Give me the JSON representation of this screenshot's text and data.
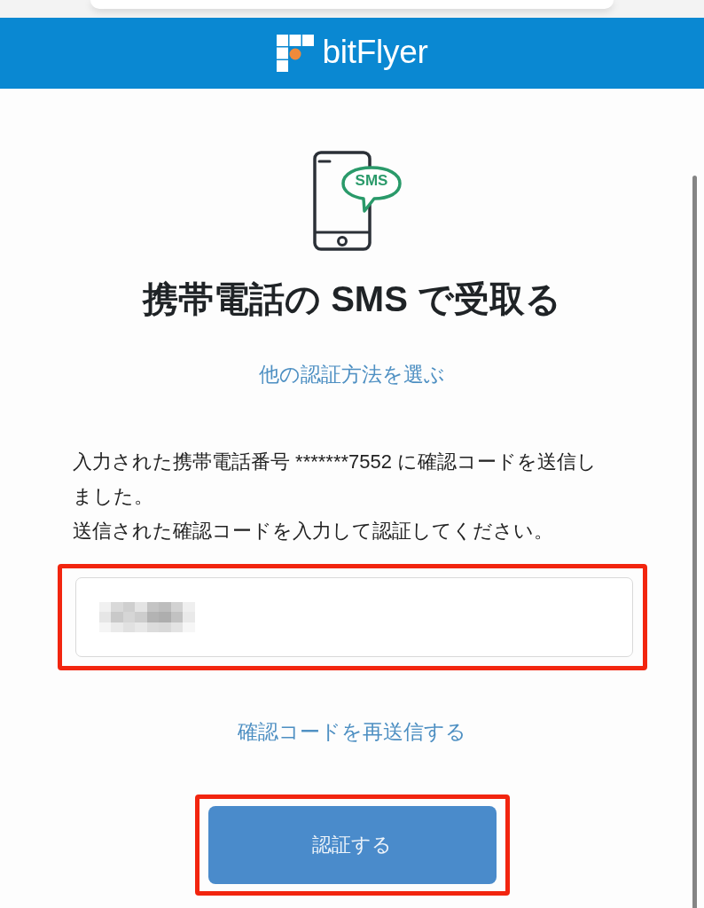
{
  "header": {
    "logo_text": "bitFlyer"
  },
  "icon": {
    "bubble_label": "SMS"
  },
  "title": "携帯電話の SMS で受取る",
  "other_method_link": "他の認証方法を選ぶ",
  "message": [
    "入力された携帯電話番号 *******7552 に確認コードを送信しました。",
    "送信された確認コードを入力して認証してください。"
  ],
  "code_field": {
    "value_obscured": true,
    "highlighted": true
  },
  "resend_link": "確認コードを再送信する",
  "submit_button": {
    "label": "認証する",
    "highlighted": true
  }
}
